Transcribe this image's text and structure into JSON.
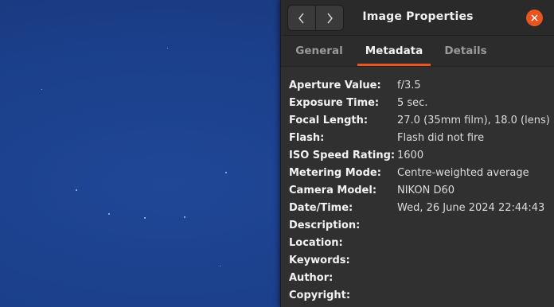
{
  "dialog": {
    "title": "Image Properties",
    "back_icon": "chevron-left-icon",
    "forward_icon": "chevron-right-icon",
    "close_icon": "close-icon",
    "accent_color": "#e95420"
  },
  "tabs": [
    {
      "label": "General",
      "active": false
    },
    {
      "label": "Metadata",
      "active": true
    },
    {
      "label": "Details",
      "active": false
    }
  ],
  "metadata": [
    {
      "label": "Aperture Value:",
      "value": "f/3.5"
    },
    {
      "label": "Exposure Time:",
      "value": "5 sec."
    },
    {
      "label": "Focal Length:",
      "value": "27.0 (35mm film), 18.0 (lens)"
    },
    {
      "label": "Flash:",
      "value": "Flash did not fire"
    },
    {
      "label": "ISO Speed Rating:",
      "value": "1600"
    },
    {
      "label": "Metering Mode:",
      "value": "Centre-weighted average"
    },
    {
      "label": "Camera Model:",
      "value": "NIKON D60"
    },
    {
      "label": "Date/Time:",
      "value": "Wed, 26 June 2024  22:44:43"
    },
    {
      "label": "Description:",
      "value": ""
    },
    {
      "label": "Location:",
      "value": ""
    },
    {
      "label": "Keywords:",
      "value": ""
    },
    {
      "label": "Author:",
      "value": ""
    },
    {
      "label": "Copyright:",
      "value": ""
    }
  ]
}
